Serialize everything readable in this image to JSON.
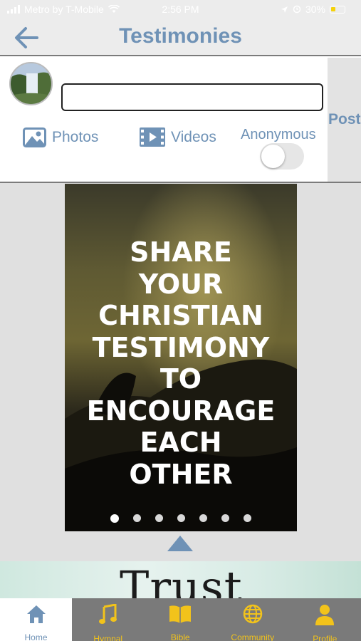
{
  "status_bar": {
    "carrier": "Metro by T-Mobile",
    "time": "2:56 PM",
    "battery": "30%"
  },
  "header": {
    "title": "Testimonies",
    "back_icon": "arrow-left-icon"
  },
  "composer": {
    "input_value": "",
    "photos_label": "Photos",
    "videos_label": "Videos",
    "anonymous_label": "Anonymous",
    "anonymous_on": false,
    "post_label": "Post"
  },
  "carousel": {
    "lines": [
      "SHARE",
      "YOUR",
      "CHRISTIAN",
      "TESTIMONY",
      "TO",
      "ENCOURAGE",
      "EACH",
      "OTHER"
    ],
    "slide_count": 7,
    "active_index": 0
  },
  "banner": {
    "text": "Trust"
  },
  "tabs": [
    {
      "label": "Home",
      "icon": "home-icon",
      "active": true
    },
    {
      "label": "Hymnal",
      "icon": "music-note-icon",
      "active": false
    },
    {
      "label": "Bible",
      "icon": "book-icon",
      "active": false
    },
    {
      "label": "Community",
      "icon": "globe-icon",
      "active": false
    },
    {
      "label": "Profile",
      "icon": "user-icon",
      "active": false
    }
  ],
  "colors": {
    "accent": "#6f92b6",
    "tab_bar": "#7a7a7a",
    "tab_inactive": "#f2c31b"
  }
}
